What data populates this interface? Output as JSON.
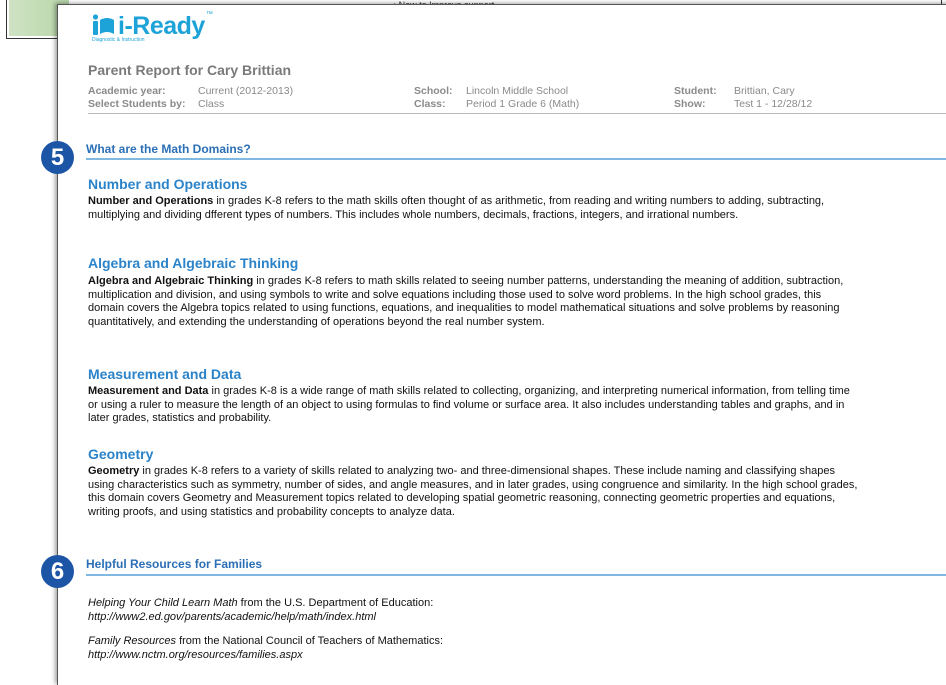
{
  "background_page": {
    "snippet": "• New to Improve support"
  },
  "logo": {
    "name": "i-Ready",
    "trademark": "™",
    "tagline": "Diagnostic & Instruction",
    "color": "#1ea3d8"
  },
  "report": {
    "title": "Parent Report for Cary Brittian",
    "fields": {
      "academic_year_label": "Academic year:",
      "academic_year_value": "Current (2012-2013)",
      "select_students_label": "Select Students by:",
      "select_students_value": "Class",
      "school_label": "School:",
      "school_value": "Lincoln Middle School",
      "class_label": "Class:",
      "class_value": "Period 1 Grade 6 (Math)",
      "student_label": "Student:",
      "student_value": "Brittian, Cary",
      "show_label": "Show:",
      "show_value": "Test 1 - 12/28/12"
    }
  },
  "sections": {
    "domains": {
      "badge": "5",
      "title": "What are the Math Domains?",
      "items": [
        {
          "heading": "Number and Operations",
          "lead": "Number and Operations",
          "text": " in grades K-8 refers to the math skills often thought of as arithmetic, from reading and writing numbers to adding, subtracting, multiplying and dividing dfferent types of numbers. This includes whole numbers, decimals, fractions, integers, and irrational numbers."
        },
        {
          "heading": "Algebra and Algebraic Thinking",
          "lead": "Algebra and Algebraic Thinking",
          "text": " in grades K-8 refers to math skills related to seeing number patterns, understanding the meaning of addition, subtraction, multiplication and division, and using symbols to write and solve equations including those used to solve word problems. In the high school grades, this domain covers the Algebra topics related to using functions, equations, and inequalities to model mathematical situations and solve problems by reasoning quantitatively, and extending the understanding of operations beyond the real number system."
        },
        {
          "heading": "Measurement and Data",
          "lead": "Measurement and Data",
          "text": " in grades K-8 is a wide range of math skills related to collecting, organizing, and interpreting numerical information, from telling time or using a ruler to measure the length of an object to using formulas to find volume or surface area. It also includes understanding tables and graphs, and in later grades, statistics and probability."
        },
        {
          "heading": "Geometry",
          "lead": "Geometry",
          "text": " in grades K-8 refers to a variety of skills related to analyzing two- and three-dimensional shapes. These include naming and classifying shapes using characteristics such as symmetry, number of sides, and angle measures, and in later grades, using congruence and similarity. In the high school grades, this domain covers Geometry and Measurement topics related to developing spatial geometric reasoning, connecting geometric properties and equations, writing proofs, and using statistics and probability concepts to analyze data."
        }
      ]
    },
    "resources": {
      "badge": "6",
      "title": "Helpful Resources for Families",
      "items": [
        {
          "title": "Helping Your Child Learn Math",
          "source": " from the U.S. Department of Education:",
          "url": "http://www2.ed.gov/parents/academic/help/math/index.html"
        },
        {
          "title": "Family Resources",
          "source": " from the National Council of Teachers of Mathematics:",
          "url": "http://www.nctm.org/resources/families.aspx"
        }
      ]
    }
  },
  "colors": {
    "section_title": "#2b6fb6",
    "section_rule": "#7fb8e0",
    "domain_heading": "#2b83c9",
    "badge": "#1d55a6"
  }
}
